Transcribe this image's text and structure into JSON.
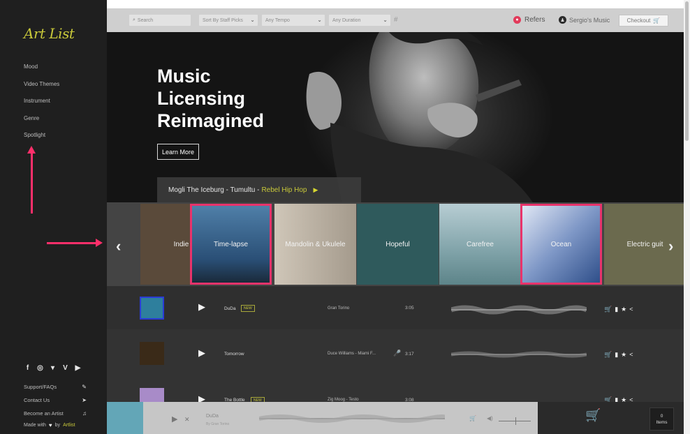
{
  "brand": {
    "logo": "Art List"
  },
  "sidebar": {
    "nav": [
      "Mood",
      "Video Themes",
      "Instrument",
      "Genre",
      "Spotlight"
    ],
    "social_icons": [
      "facebook-icon",
      "instagram-icon",
      "twitter-icon",
      "vimeo-icon",
      "youtube-icon"
    ],
    "social_glyphs": [
      "f",
      "◎",
      "▾",
      "V",
      "▶"
    ],
    "footer_links": [
      {
        "label": "Support/FAQs",
        "icon": "wrench-icon",
        "glyph": "✎"
      },
      {
        "label": "Contact Us",
        "icon": "send-icon",
        "glyph": "➤"
      },
      {
        "label": "Become an Artist",
        "icon": "music-note-icon",
        "glyph": "♫"
      }
    ],
    "made_with": {
      "prefix": "Made with",
      "heart": "♥",
      "by": "by",
      "name": "Artlist"
    }
  },
  "topbar": {
    "search_placeholder": "Search",
    "sort": "Sort By Staff Picks",
    "tempo": "Any Tempo",
    "duration": "Any Duration",
    "hash": "#",
    "refers_label": "Refers",
    "user_label": "Sergio's Music",
    "checkout_label": "Checkout"
  },
  "hero": {
    "title_lines": [
      "Music",
      "Licensing",
      "Reimagined"
    ],
    "cta": "Learn More",
    "now_playing": {
      "track": "Mogli The Iceburg - Tumultu -",
      "genre": "Rebel Hip Hop"
    }
  },
  "carousel": {
    "prev": "‹",
    "next": "›",
    "tiles": [
      {
        "label": "Indie",
        "color": "#5a4a3a",
        "highlighted": false
      },
      {
        "label": "Time-lapse",
        "color": "#4f7fa8",
        "highlighted": true
      },
      {
        "label": "Mandolin & Ukulele",
        "color": "#b9b1a5",
        "highlighted": false
      },
      {
        "label": "Hopeful",
        "color": "#2f5a5c",
        "highlighted": false
      },
      {
        "label": "Carefree",
        "color": "#87a9ad",
        "highlighted": false
      },
      {
        "label": "Ocean",
        "color": "#93a8cf",
        "highlighted": true
      },
      {
        "label": "Electric guit",
        "color": "#6b6a4e",
        "highlighted": false
      }
    ]
  },
  "tracks": [
    {
      "name": "DuDa",
      "badge": "NEW",
      "artist": "Gran Torino",
      "duration": "3:05",
      "thumb_color": "#2e7f9d",
      "has_mic": false
    },
    {
      "name": "Tomorrow",
      "badge": "",
      "artist": "Duce Williams - Miami F...",
      "duration": "3:17",
      "thumb_color": "#3a2a18",
      "has_mic": true
    },
    {
      "name": "The Bottle",
      "badge": "NEW",
      "artist": "Zig Moog - Testo",
      "duration": "3:08",
      "thumb_color": "#a88bc8",
      "has_mic": false
    }
  ],
  "track_action_glyphs": [
    "🛒",
    "▮",
    "★",
    "<"
  ],
  "player": {
    "track": "DuDa",
    "artist": "By Gran Torino",
    "play_glyph": "▶",
    "close_glyph": "✕",
    "cart_glyph": "🛒",
    "vol_glyph": "◀)"
  },
  "cart": {
    "count": "0",
    "label": "Items"
  },
  "colors": {
    "accent": "#c8c83a",
    "highlight": "#e8336b",
    "arrow": "#ff2f6a"
  }
}
